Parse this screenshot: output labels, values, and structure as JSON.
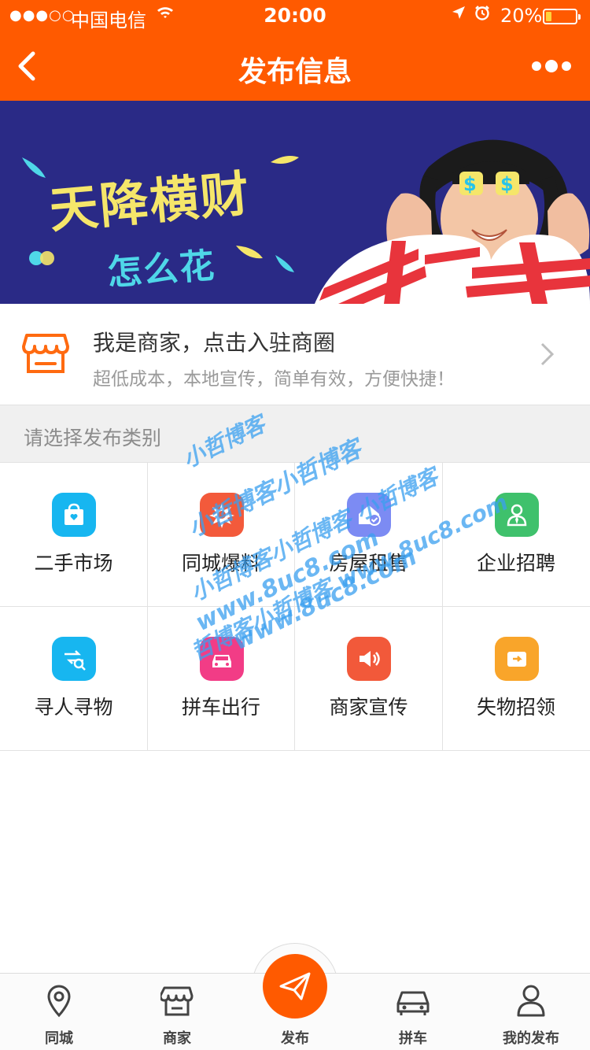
{
  "status_bar": {
    "signal": "●●●○○",
    "carrier": "中国电信",
    "time": "20:00",
    "battery_percent": "20%",
    "battery_level": 0.2
  },
  "header": {
    "title": "发布信息"
  },
  "banner": {
    "headline": "天降横财",
    "subline": "怎么花"
  },
  "merchant": {
    "title": "我是商家，点击入驻商圈",
    "subtitle": "超低成本，本地宣传，简单有效，方便快捷！"
  },
  "section": {
    "header": "请选择发布类别"
  },
  "categories": [
    {
      "label": "二手市场",
      "icon": "gift-bag-icon",
      "color": "#17b6f0"
    },
    {
      "label": "同城爆料",
      "icon": "burst-icon",
      "color": "#f35a3b"
    },
    {
      "label": "房屋租售",
      "icon": "house-icon",
      "color": "#7c8bf3"
    },
    {
      "label": "企业招聘",
      "icon": "person-tie-icon",
      "color": "#3fc16c"
    },
    {
      "label": "寻人寻物",
      "icon": "search-arrows-icon",
      "color": "#17b6f0"
    },
    {
      "label": "拼车出行",
      "icon": "car-icon",
      "color": "#f23c86"
    },
    {
      "label": "商家宣传",
      "icon": "speaker-icon",
      "color": "#f2593a"
    },
    {
      "label": "失物招领",
      "icon": "wallet-icon",
      "color": "#f9a52a"
    }
  ],
  "watermark": {
    "line1": "小哲博客",
    "line2": "小哲博客小哲博客",
    "line3": "小哲博客小哲博客 小哲博客",
    "line4": "哲博客小哲博客 www.8uc8.com",
    "line5": "www.8uc8.com",
    "line6": "www.8uc8.com"
  },
  "tabbar": {
    "items": [
      {
        "label": "同城",
        "icon": "location-pin-icon"
      },
      {
        "label": "商家",
        "icon": "store-icon"
      },
      {
        "label": "发布",
        "icon": "paper-plane-icon"
      },
      {
        "label": "拼车",
        "icon": "car-icon"
      },
      {
        "label": "我的发布",
        "icon": "user-icon"
      }
    ]
  },
  "colors": {
    "brand": "#ff5a00",
    "banner_bg": "#2a2a86"
  }
}
